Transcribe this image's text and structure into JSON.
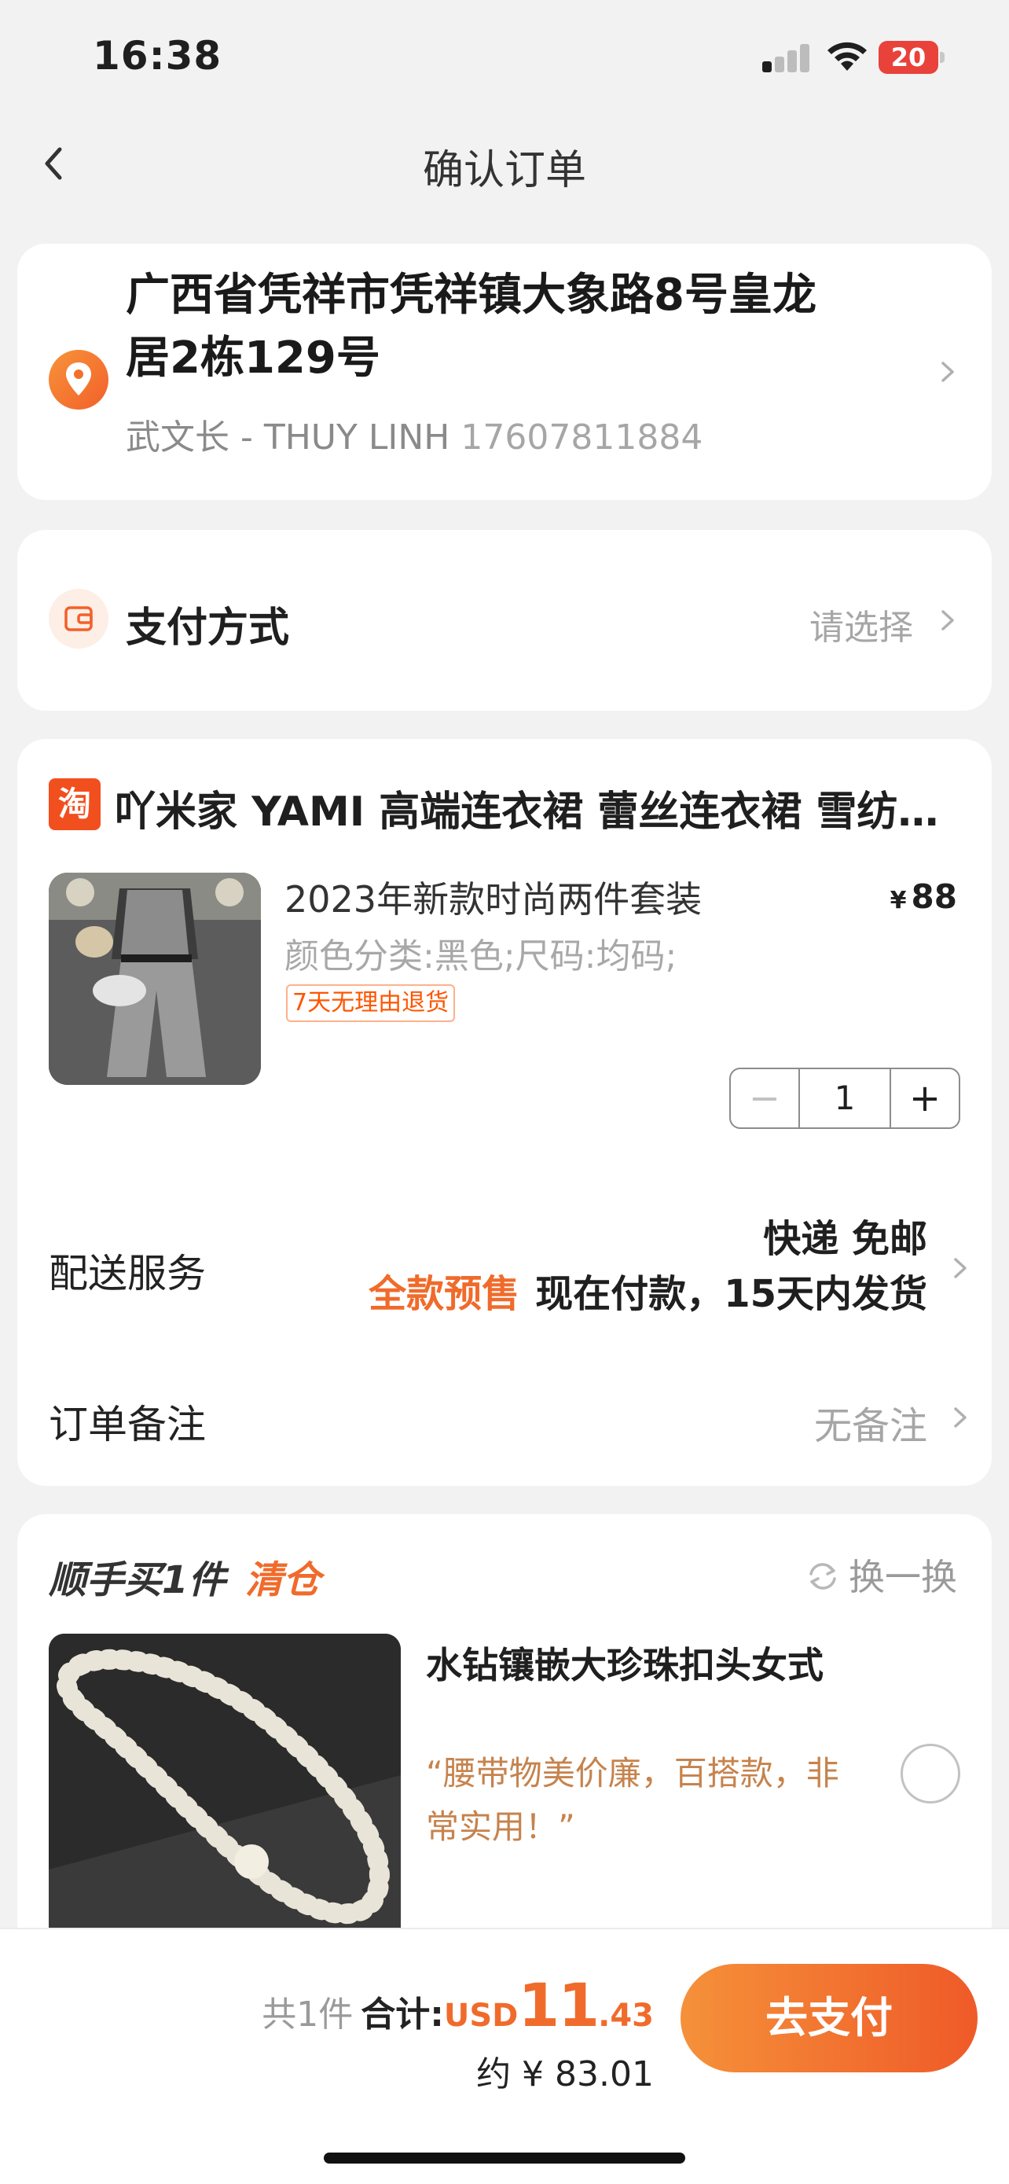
{
  "status_bar": {
    "time": "16:38",
    "battery": "20",
    "signal_bars_active": 1,
    "signal_bars_total": 4
  },
  "nav": {
    "title": "确认订单"
  },
  "address": {
    "line1": "广西省凭祥市凭祥镇大象路8号皇龙",
    "line2": "居2栋129号",
    "contact": "武文长 - THUY LINH",
    "phone": "17607811884"
  },
  "payment": {
    "label": "支付方式",
    "choose": "请选择"
  },
  "order": {
    "shop_badge": "淘",
    "shop_name": "吖米家 YAMI 高端连衣裙 蕾丝连衣裙 雪纺…",
    "product": {
      "title": "2023年新款时尚两件套装",
      "spec": "颜色分类:黑色;尺码:均码;",
      "badge": "7天无理由退货",
      "price_symbol": "¥",
      "price": "88",
      "quantity": "1"
    },
    "shipping": {
      "label": "配送服务",
      "line1": "快递 免邮",
      "presale": "全款预售",
      "line2_rest": "现在付款，15天内发货"
    },
    "note": {
      "label": "订单备注",
      "value": "无备注"
    }
  },
  "recommend": {
    "title": "顺手买1件",
    "tag": "清仓",
    "swap": "换一换",
    "item_name": "水钻镶嵌大珍珠扣头女式",
    "quote": "“腰带物美价廉，百搭款，非常实用！”"
  },
  "footer": {
    "count": "共1件",
    "total_label": "合计:",
    "currency": "USD",
    "amount_int": "11",
    "amount_dec": ".43",
    "approx": "约 ¥ 83.01",
    "pay_button": "去支付"
  },
  "colors": {
    "accent": "#f06b2b",
    "brand_red": "#f24f1f",
    "background": "#f2f2f2"
  }
}
